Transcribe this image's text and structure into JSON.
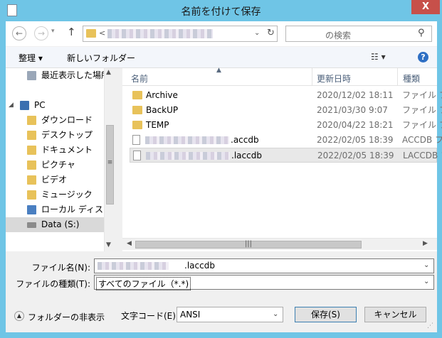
{
  "window": {
    "title": "名前を付けて保存",
    "close_label": "X"
  },
  "address": {
    "prefix": "<",
    "search_placeholder": "の検索"
  },
  "toolbar": {
    "organize_label": "整理 ▾",
    "new_folder_label": "新しいフォルダー"
  },
  "nav": {
    "items": [
      {
        "label": "最近表示した場所",
        "icon": "recent-places-icon"
      },
      {
        "label": "PC",
        "icon": "computer-icon"
      },
      {
        "label": "ダウンロード",
        "icon": "downloads-folder-icon"
      },
      {
        "label": "デスクトップ",
        "icon": "desktop-folder-icon"
      },
      {
        "label": "ドキュメント",
        "icon": "documents-folder-icon"
      },
      {
        "label": "ピクチャ",
        "icon": "pictures-folder-icon"
      },
      {
        "label": "ビデオ",
        "icon": "videos-folder-icon"
      },
      {
        "label": "ミュージック",
        "icon": "music-folder-icon"
      },
      {
        "label": "ローカル ディスク (C",
        "icon": "local-disk-icon"
      },
      {
        "label": "Data (S:)",
        "icon": "data-drive-icon"
      }
    ]
  },
  "file_list": {
    "columns": {
      "name": "名前",
      "date": "更新日時",
      "type": "種類"
    },
    "rows": [
      {
        "name": "Archive",
        "date": "2020/12/02 18:11",
        "type": "ファイル フ",
        "kind": "folder"
      },
      {
        "name": "BackUP",
        "date": "2021/03/30 9:07",
        "type": "ファイル フ",
        "kind": "folder"
      },
      {
        "name": "TEMP",
        "date": "2020/04/22 18:21",
        "type": "ファイル フ",
        "kind": "folder"
      },
      {
        "name": ".accdb",
        "date": "2022/02/05 18:39",
        "type": "ACCDB ファ",
        "kind": "file"
      },
      {
        "name": ".laccdb",
        "date": "2022/02/05 18:39",
        "type": "LACCDB フ",
        "kind": "file"
      }
    ]
  },
  "form": {
    "filename_label": "ファイル名(N):",
    "filename_value": ".laccdb",
    "filetype_label": "ファイルの種類(T):",
    "filetype_value": "すべてのファイル（*.*)",
    "hide_folders_label": "フォルダーの非表示",
    "encoding_label": "文字コード(E):",
    "encoding_value": "ANSI",
    "save_label": "保存(S)",
    "cancel_label": "キャンセル"
  },
  "colors": {
    "titlebar": "#6fc5e6",
    "close_button": "#c7504a",
    "folder": "#e8c25a",
    "selection": "#e8e8e8"
  }
}
